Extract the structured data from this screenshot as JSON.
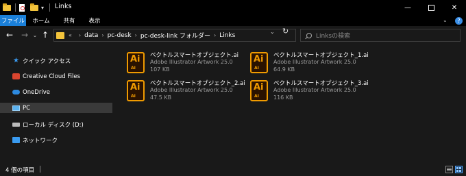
{
  "window": {
    "title": "Links",
    "quick_access_dropdown": "▾",
    "minimize": "—",
    "close": "✕"
  },
  "ribbon": {
    "tabs": [
      "ファイル",
      "ホーム",
      "共有",
      "表示"
    ],
    "active_tab_color": "#1a7fd8",
    "expand": "⌄",
    "help": "?"
  },
  "nav": {
    "back": "←",
    "forward": "→",
    "recent": "⌄",
    "up": "↑"
  },
  "address": {
    "overflow": "«",
    "breadcrumbs": [
      "data",
      "pc-desk",
      "pc-desk-link フォルダー",
      "Links"
    ],
    "separator": "›",
    "dropdown": "⌄",
    "refresh": "↻"
  },
  "search": {
    "placeholder": "Linksの検索"
  },
  "sidebar": {
    "items": [
      {
        "label": "クイック アクセス",
        "icon": "star-icon"
      },
      {
        "label": "Creative Cloud Files",
        "icon": "creative-cloud-icon"
      },
      {
        "label": "OneDrive",
        "icon": "onedrive-icon"
      },
      {
        "label": "PC",
        "icon": "pc-icon",
        "selected": true
      },
      {
        "label": "ローカル ディスク (D:)",
        "icon": "drive-icon"
      },
      {
        "label": "ネットワーク",
        "icon": "network-icon"
      }
    ]
  },
  "files": [
    {
      "name": "ベクトルスマートオブジェクト.ai",
      "type": "Adobe Illustrator Artwork 25.0",
      "size": "107 KB"
    },
    {
      "name": "ベクトルスマートオブジェクト_1.ai",
      "type": "Adobe Illustrator Artwork 25.0",
      "size": "64.9 KB"
    },
    {
      "name": "ベクトルスマートオブジェクト_2.ai",
      "type": "Adobe Illustrator Artwork 25.0",
      "size": "47.5 KB"
    },
    {
      "name": "ベクトルスマートオブジェクト_3.ai",
      "type": "Adobe Illustrator Artwork 25.0",
      "size": "116 KB"
    }
  ],
  "ai_icon": {
    "big": "Ai",
    "small": "AI",
    "color": "#f09b00"
  },
  "status": {
    "count": "4 個の項目"
  }
}
